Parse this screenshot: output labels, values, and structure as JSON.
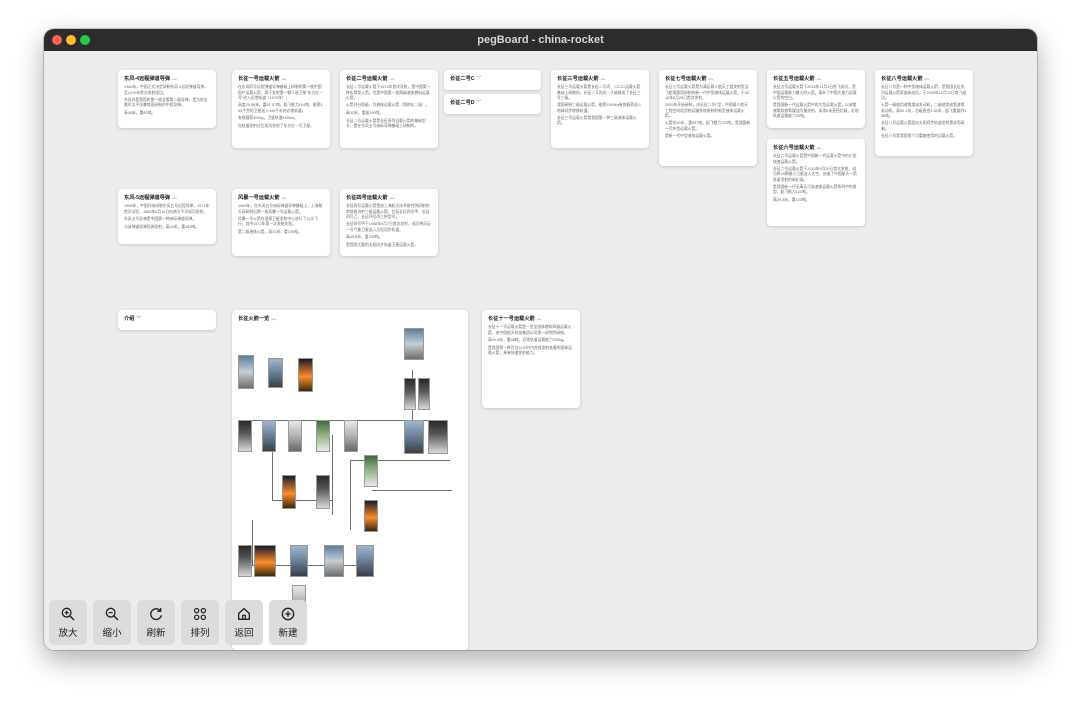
{
  "window": {
    "title": "pegBoard - china-rocket"
  },
  "cards": {
    "df4": {
      "title": "东风-4远程弹道导弹",
      "p": [
        "1965年，中国正式决定研制东风-4远程弹道导弹，至1970年首次发射成功。",
        "东风四是我国的第一枚全氢氧二级导弹，是为攻击美军太平洋基地而研制的中程导弹。",
        "高28米，重82吨。"
      ]
    },
    "cz1": {
      "title": "长征一号运载火箭",
      "p": [
        "在东风四号远程弹道导弹基础上研制的第一枚中国国产运载火箭，用于发射第一颗人造卫星\"东方红一号\"进入近地轨道（1970年）。",
        "高度29.86米，重81.57吨，起飞推力104吨，能把300千克的卫星送入440千米的近地轨道。",
        "有效载荷300kg，卫星轨道440km。",
        "在轨道发射过后成功发射了东方红一号卫星。"
      ]
    },
    "cz2": {
      "title": "长征二号运载火箭",
      "p": [
        "长征二号运载火箭于1974年首次发射，是中国第一种实用型火箭，也是中国第一枚两级液体燃料运载火箭。",
        "火箭共分两级，为液体运载火箭（简称长二极）。",
        "高32米，重量190吨。",
        "长征二号运载火箭是长征系列运载火箭的基础型号，是在东风五号洲际导弹基础上研制的。",
        "长征二号运载火箭衍生出长征二号丙、长征二号丁、长征二号E、长征二号F等型号。"
      ]
    },
    "cz2c": {
      "title": "长征二号C"
    },
    "cz2d": {
      "title": "长征二号D"
    },
    "cz3": {
      "title": "长征三号运载火箭",
      "p": [
        "长征三号运载火箭是长征二号丙、CZ-2C运载火箭基础上研制的，长征二号丙的二子级换成了长征三号三级。",
        "我国研制三级运载火箭，能把1500kg有效载荷送入地球同步转移轨道。",
        "长征三号运载火箭是我国第一种三级液体运载火箭。"
      ]
    },
    "cz7": {
      "title": "长征七号运载火箭",
      "p": [
        "长征七号运载火箭是为满足载人航天工程发射货运飞船需要而研制的新一代中型液体运载火箭，于2016年6月25日首次发射。",
        "2009年开始研制，由长征二号F型，中国载人航天工程空间站货物运输系统研制的新型液体运载火箭。",
        "火箭长53米，重597吨，起飞推力720吨，是我国新一代中型运载火箭。",
        "是新一代中型液体运载火箭。"
      ]
    },
    "cz5": {
      "title": "长征五号运载火箭",
      "p": [
        "长征五号运载火箭于2016年11月3日首飞成功，是中国运载能力最大的火箭，填补了中国大推力运载火箭的空白。",
        "是我国新一代运载火箭中的大型运载火箭，以液氢液氧和液氧煤油为推进剂，采用5米直径芯级，近地轨道运载能力25吨。"
      ]
    },
    "cz8": {
      "title": "长征八号运载火箭",
      "p": [
        "长征八号是一种中型液体运载火箭，是我国长征系列运载火箭家族新成员，于2020年12月22日首飞成功。",
        "火箭一级使用液氧煤油发动机，二级使用液氢液氧发动机，高50.3米，芯级直径3.35米，起飞重量约356吨。",
        "长征八号运载火箭面向太阳同步轨道发射需求而研制。",
        "长征八号是我国首个可重复使用的运载火箭。"
      ]
    },
    "cz6": {
      "title": "长征六号运载火箭",
      "p": [
        "长征六号运载火箭是中国新一代运载火箭中的小型快速运载火箭。",
        "长征六号运载火箭于2015年9月20日首次发射，成功将20颗微小卫星送入太空，创造了中国航天一箭多星发射的新纪录。",
        "是我国新一代无毒无污染液体运载火箭系列中的首型，起飞推力120吨。",
        "高29.3米，重103吨。"
      ]
    },
    "df5": {
      "title": "东风-5远程弹道导弹",
      "p": [
        "1965年，中国开始研制东风五号远程导弹，1971年首次试验，1980年5月18日向南太平洋成功发射。",
        "东风五号导弹是中国第一种洲际弹道导弹。",
        "与该弹道导弹同源发射，高32米，重183吨。"
      ]
    },
    "fb1": {
      "title": "风暴一号运载火箭",
      "p": [
        "1969年，在东风五号洲际弹道导弹基础上，上海航天局研制出第一枚风暴一号运载火箭。",
        "风暴一号火箭在酒泉卫星发射中心进行了11次飞行，其中1972年第一次发射失败。",
        "是二级液体火箭，高33米，重190吨。"
      ]
    },
    "cz4": {
      "title": "长征四号运载火箭",
      "p": [
        "长征四号运载火箭是由上海航天技术研究院研制的常规推进剂三级运载火箭，包括长征四号甲、长征四号乙、长征四号丙三种型号。",
        "长征四号甲于1988年9月7日首次发射，成功将风云一号气象卫星送入太阳同步轨道。",
        "高45.8米，重249吨。",
        "是我国主要的太阳同步轨道卫星运载火箭。"
      ]
    },
    "intro": {
      "title": "介绍"
    },
    "family": {
      "title": "长征火箭一览"
    },
    "cz11": {
      "title": "长征十一号运载火箭",
      "p": [
        "长征十一号运载火箭是一型全固体燃料四级运载火箭，由中国航天科技集团公司第一研究院研制。",
        "高20.8米，重58吨，近地轨道运载能力700kg。",
        "是我国第一种可在24小时内完成发射准备的固体运载火箭，具有快速发射能力。"
      ]
    }
  },
  "toolbar": [
    {
      "label": "放大",
      "icon": "zoom-in-icon"
    },
    {
      "label": "缩小",
      "icon": "zoom-out-icon"
    },
    {
      "label": "刷新",
      "icon": "refresh-icon"
    },
    {
      "label": "排列",
      "icon": "grid-icon"
    },
    {
      "label": "返回",
      "icon": "home-icon"
    },
    {
      "label": "新建",
      "icon": "add-icon"
    }
  ]
}
